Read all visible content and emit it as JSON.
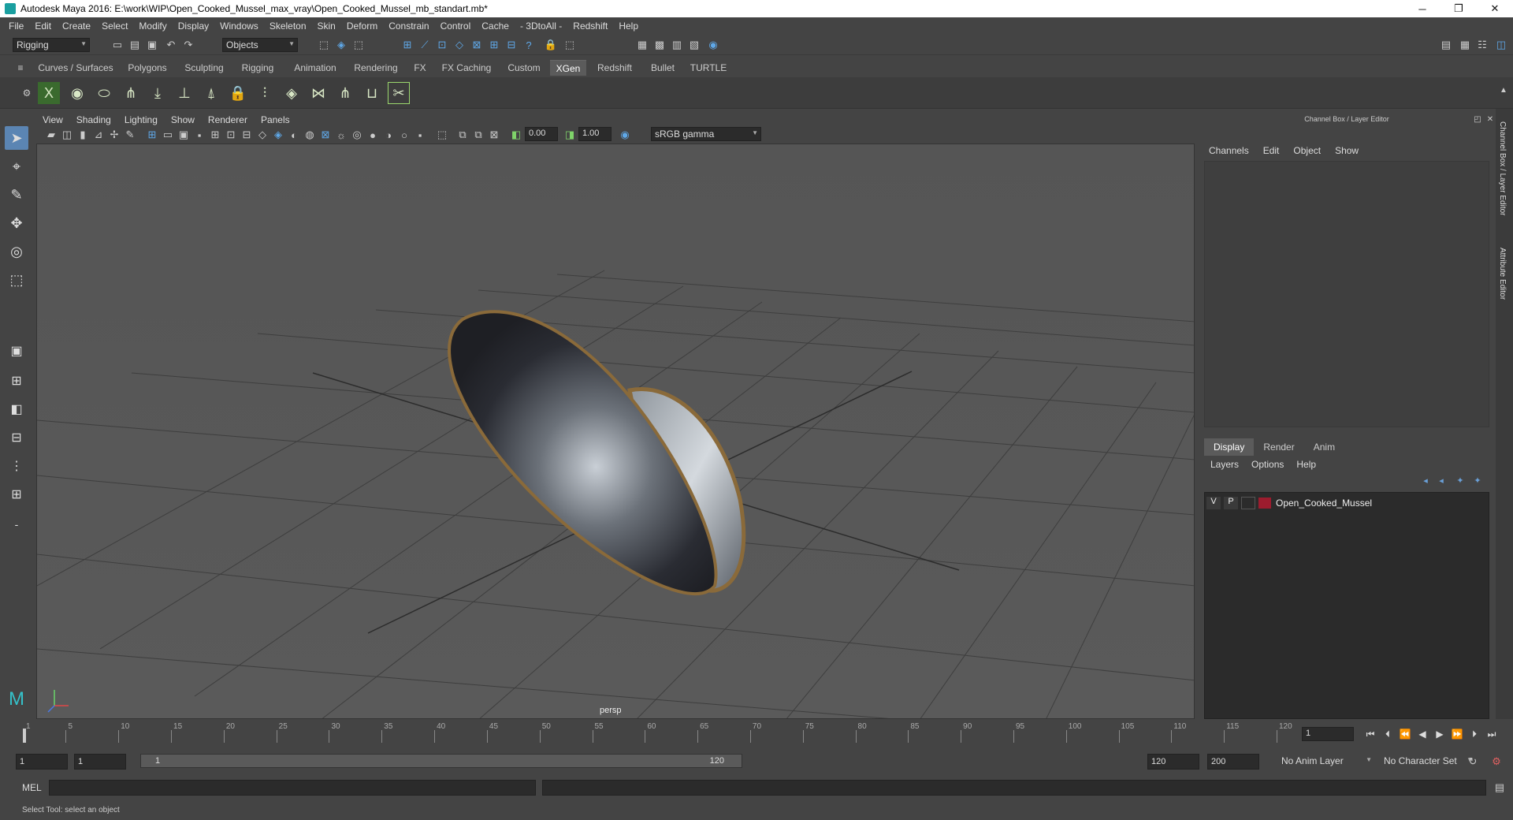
{
  "window": {
    "title": "Autodesk Maya 2016: E:\\work\\WIP\\Open_Cooked_Mussel_max_vray\\Open_Cooked_Mussel_mb_standart.mb*",
    "buttons": [
      "─",
      "❐",
      "✕"
    ]
  },
  "menubar": [
    "File",
    "Edit",
    "Create",
    "Select",
    "Modify",
    "Display",
    "Windows",
    "Skeleton",
    "Skin",
    "Deform",
    "Constrain",
    "Control",
    "Cache",
    "- 3DtoAll -",
    "Redshift",
    "Help"
  ],
  "statusline": {
    "menuset": "Rigging",
    "selection_mode": "Objects"
  },
  "shelf_tabs": [
    "Curves / Surfaces",
    "Polygons",
    "Sculpting",
    "Rigging",
    "Animation",
    "Rendering",
    "FX",
    "FX Caching",
    "Custom",
    "XGen",
    "Redshift",
    "Bullet",
    "TURTLE"
  ],
  "shelf_active": "XGen",
  "panel_menu": [
    "View",
    "Shading",
    "Lighting",
    "Show",
    "Renderer",
    "Panels"
  ],
  "panel_toolbar": {
    "exposure": "0.00",
    "gamma": "1.00",
    "color_space": "sRGB gamma"
  },
  "viewport": {
    "camera_label": "persp"
  },
  "channel_box": {
    "header": "Channel Box / Layer Editor",
    "menu": [
      "Channels",
      "Edit",
      "Object",
      "Show"
    ]
  },
  "layer_editor": {
    "tabs": [
      "Display",
      "Render",
      "Anim"
    ],
    "active_tab": "Display",
    "menu": [
      "Layers",
      "Options",
      "Help"
    ],
    "layers": [
      {
        "v": "V",
        "p": "P",
        "name": "Open_Cooked_Mussel",
        "color": "#9c1c2e"
      }
    ]
  },
  "side_tabs": [
    "Channel Box / Layer Editor",
    "Attribute Editor"
  ],
  "time_slider": {
    "labels": [
      "1",
      "5",
      "10",
      "15",
      "20",
      "25",
      "30",
      "35",
      "40",
      "45",
      "50",
      "55",
      "60",
      "65",
      "70",
      "75",
      "80",
      "85",
      "90",
      "95",
      "100",
      "105",
      "110",
      "115",
      "120"
    ],
    "current_frame": "1"
  },
  "range": {
    "start": "1",
    "playback_start": "1",
    "slider_start": "1",
    "slider_end": "120",
    "playback_end": "120",
    "end": "200",
    "anim_layer": "No Anim Layer",
    "character_set": "No Character Set"
  },
  "command_line": {
    "language": "MEL"
  },
  "help_line": "Select Tool: select an object"
}
